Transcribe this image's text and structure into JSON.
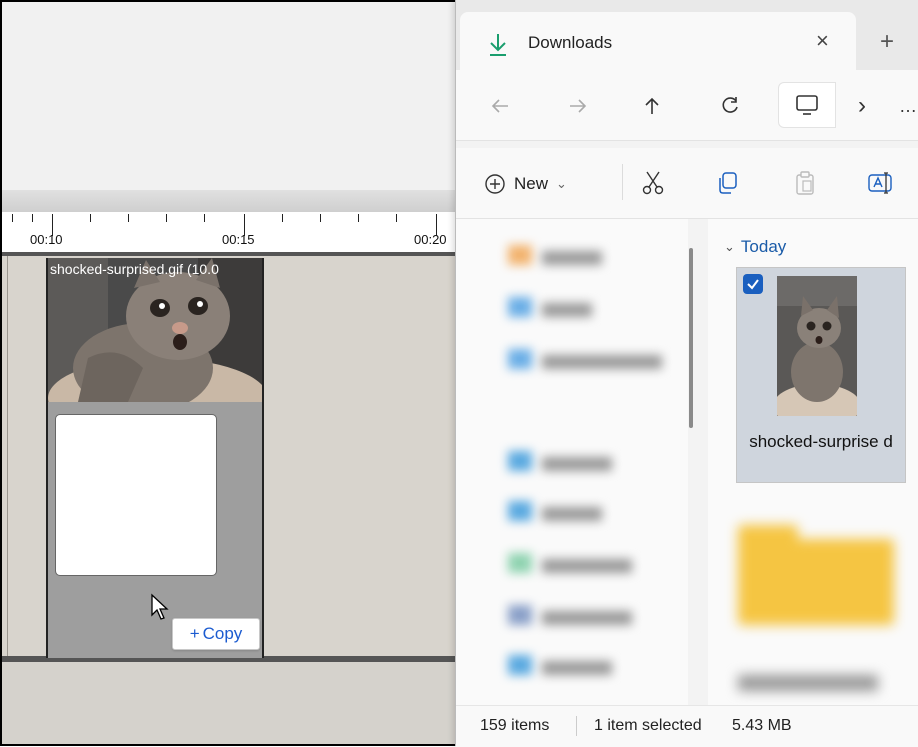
{
  "editor": {
    "ruler_labels": [
      "00:10",
      "00:15",
      "00:20"
    ],
    "clip_title": "shocked-surprised.gif (10.0",
    "copy_tooltip": {
      "icon": "plus-icon",
      "label": "Copy"
    }
  },
  "explorer": {
    "tab": {
      "title": "Downloads",
      "icon": "download-arrow-icon",
      "close_glyph": "×",
      "new_glyph": "+"
    },
    "nav": {
      "back": "back-arrow-icon",
      "forward": "forward-arrow-icon",
      "up": "up-arrow-icon",
      "refresh": "refresh-icon",
      "view": "monitor-icon",
      "more_glyph": "…",
      "chevron_glyph": "›"
    },
    "commands": {
      "new_label": "New",
      "new_chevron": "⌄",
      "icons": [
        "cut-icon",
        "copy-icon",
        "paste-icon",
        "rename-icon"
      ]
    },
    "group": {
      "label": "Today",
      "chevron": "⌄"
    },
    "file": {
      "name": "shocked-surprise d",
      "selected": true
    },
    "status": {
      "items_count": "159 items",
      "selection": "1 item selected",
      "size": "5.43 MB"
    },
    "colors": {
      "accent": "#1a5fbf",
      "download_green": "#1a9e6e",
      "folder_yellow": "#f5c542"
    }
  }
}
